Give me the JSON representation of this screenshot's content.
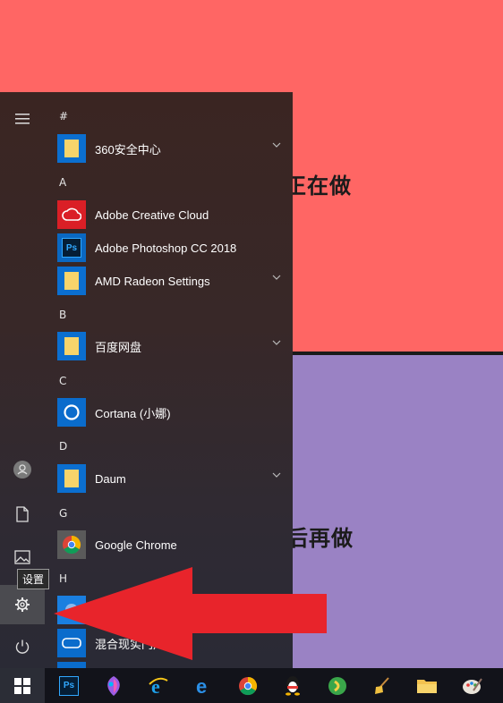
{
  "desktop": {
    "top_text": "正在做",
    "bottom_text": "后再做",
    "colors": {
      "top": "#ff6664",
      "bottom": "#9a82c4"
    }
  },
  "start_menu": {
    "rail": {
      "hamburger_icon": "hamburger-icon",
      "user_icon": "user-icon",
      "documents_icon": "document-icon",
      "pictures_icon": "pictures-icon",
      "settings_icon": "gear-icon",
      "power_icon": "power-icon",
      "tooltip": "设置"
    },
    "sections": [
      {
        "letter": "#",
        "apps": [
          {
            "name": "360安全中心",
            "icon": "folder-icon",
            "expandable": true
          }
        ]
      },
      {
        "letter": "A",
        "apps": [
          {
            "name": "Adobe Creative Cloud",
            "icon": "creative-cloud-icon",
            "expandable": false
          },
          {
            "name": "Adobe Photoshop CC 2018",
            "icon": "photoshop-icon",
            "expandable": false
          },
          {
            "name": "AMD Radeon Settings",
            "icon": "folder-icon",
            "expandable": true
          }
        ]
      },
      {
        "letter": "B",
        "apps": [
          {
            "name": "百度网盘",
            "icon": "folder-icon",
            "expandable": true
          }
        ]
      },
      {
        "letter": "C",
        "apps": [
          {
            "name": "Cortana (小娜)",
            "icon": "cortana-icon",
            "expandable": false
          }
        ]
      },
      {
        "letter": "D",
        "apps": [
          {
            "name": "Daum",
            "icon": "folder-icon",
            "expandable": true
          }
        ]
      },
      {
        "letter": "G",
        "apps": [
          {
            "name": "Google Chrome",
            "icon": "chrome-icon",
            "expandable": false
          }
        ]
      },
      {
        "letter": "H",
        "apps": [
          {
            "name": "",
            "icon": "app-icon",
            "expandable": false
          },
          {
            "name": "混合现实门户",
            "icon": "mixed-reality-icon",
            "expandable": false
          }
        ]
      }
    ]
  },
  "taskbar": {
    "items": [
      "windows-start-icon",
      "photoshop-icon",
      "paint-icon",
      "internet-explorer-icon",
      "edge-icon",
      "chrome-icon",
      "qq-icon",
      "green-app-icon",
      "broom-icon",
      "folder-icon",
      "paint-palette-icon"
    ]
  }
}
